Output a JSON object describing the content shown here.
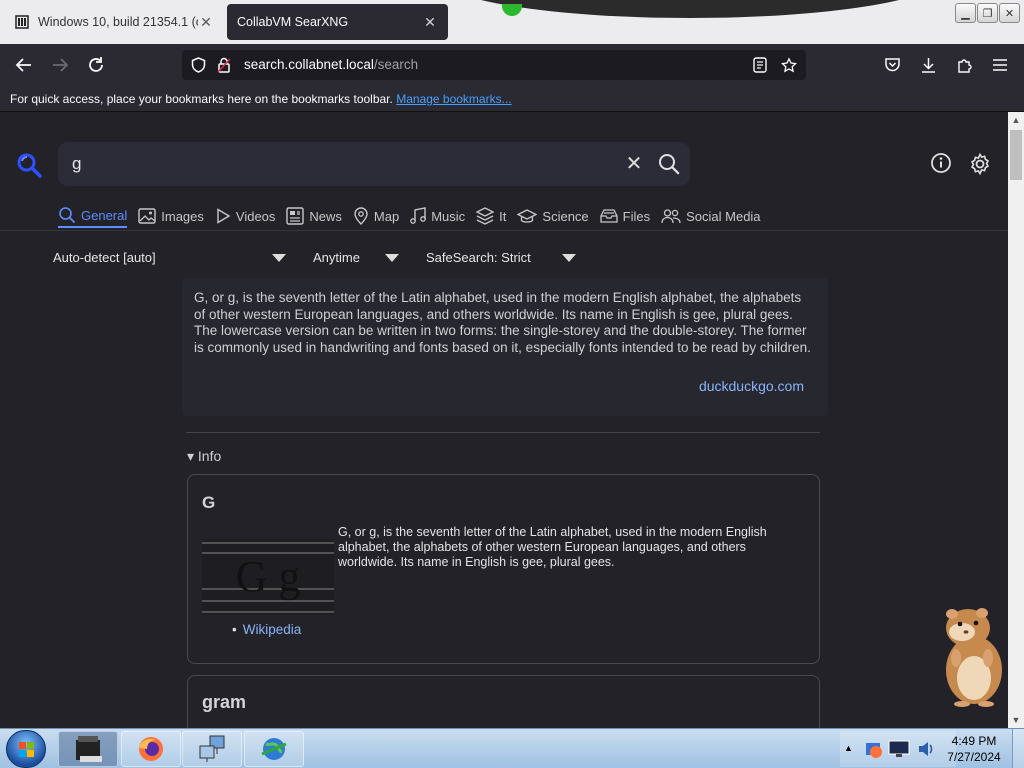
{
  "browser": {
    "tabs": [
      {
        "title": "Windows 10, build 21354.1 (co_",
        "active": false
      },
      {
        "title": "CollabVM SearXNG",
        "active": true
      }
    ],
    "url": {
      "host": "search.collabnet.local",
      "path": "/search"
    },
    "bookmarks_hint": "For quick access, place your bookmarks here on the bookmarks toolbar.",
    "bookmarks_link": "Manage bookmarks..."
  },
  "search": {
    "query": "g",
    "categories": [
      {
        "label": "General",
        "icon": "search-icon",
        "active": true
      },
      {
        "label": "Images",
        "icon": "image-icon"
      },
      {
        "label": "Videos",
        "icon": "play-icon"
      },
      {
        "label": "News",
        "icon": "newspaper-icon"
      },
      {
        "label": "Map",
        "icon": "map-pin-icon"
      },
      {
        "label": "Music",
        "icon": "music-note-icon"
      },
      {
        "label": "It",
        "icon": "layers-icon"
      },
      {
        "label": "Science",
        "icon": "graduation-cap-icon"
      },
      {
        "label": "Files",
        "icon": "file-tray-icon"
      },
      {
        "label": "Social Media",
        "icon": "people-icon"
      }
    ],
    "filters": {
      "language": "Auto-detect [auto]",
      "time": "Anytime",
      "safesearch": "SafeSearch: Strict"
    }
  },
  "answer": {
    "text": "G, or g, is the seventh letter of the Latin alphabet, used in the modern English alphabet, the alphabets of other western European languages, and others worldwide. Its name in English is gee, plural gees. The lowercase version can be written in two forms: the single-storey and the double-storey. The former is commonly used in handwriting and fonts based on it, especially fonts intended to be read by children.",
    "source": "duckduckgo.com"
  },
  "info": {
    "summary": "Info",
    "boxes": [
      {
        "title": "G",
        "image_glyph": "G g",
        "text": "G, or g, is the seventh letter of the Latin alphabet, used in the modern English alphabet, the alphabets of other western European languages, and others worldwide. Its name in English is gee, plural gees.",
        "link": "Wikipedia"
      },
      {
        "title": "gram"
      }
    ]
  },
  "taskbar": {
    "time": "4:49 PM",
    "date": "7/27/2024"
  },
  "colors": {
    "accent": "#5b8dff",
    "page_bg": "#222228",
    "link": "#8ab4f8"
  }
}
